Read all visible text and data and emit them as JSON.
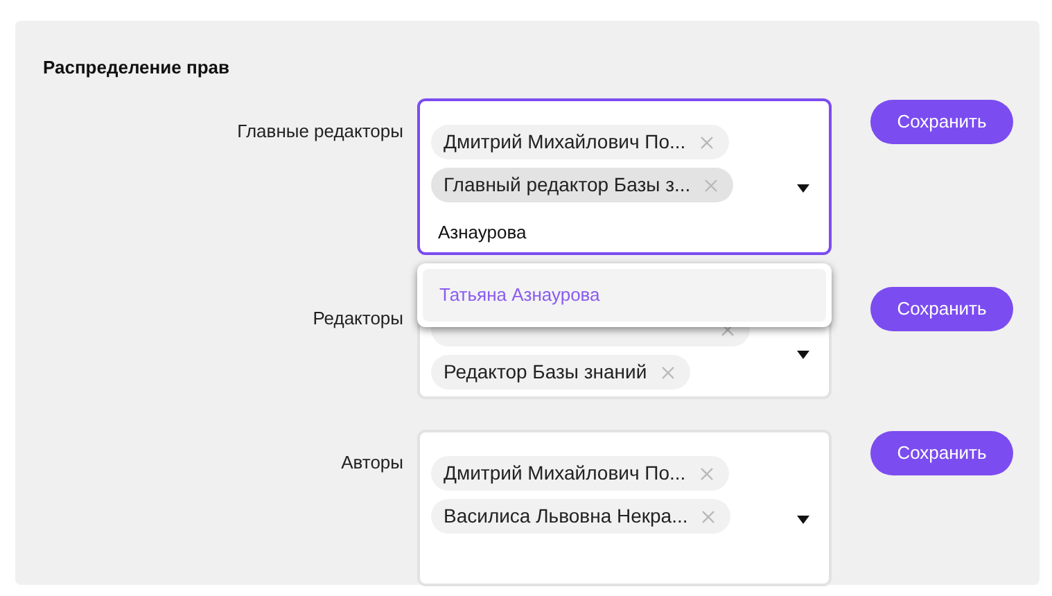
{
  "section_title": "Распределение прав",
  "rows": [
    {
      "label": "Главные редакторы",
      "focused": true,
      "search": "Азнаурова",
      "chips": [
        {
          "text": "Дмитрий Михайлович По...",
          "highlighted": false
        },
        {
          "text": "Главный редактор Базы з...",
          "highlighted": true
        }
      ],
      "options": [
        {
          "text": "Татьяна Азнаурова"
        }
      ],
      "button": "Сохранить"
    },
    {
      "label": "Редакторы",
      "focused": false,
      "chips": [
        {
          "highlighted": false
        },
        {
          "text": "Редактор Базы знаний",
          "highlighted": false
        }
      ],
      "button": "Сохранить"
    },
    {
      "label": "Авторы",
      "focused": false,
      "chips": [
        {
          "text": "Дмитрий Михайлович По...",
          "highlighted": false
        },
        {
          "text": "Василиса Львовна Некра...",
          "highlighted": false
        }
      ],
      "button": "Сохранить"
    }
  ]
}
